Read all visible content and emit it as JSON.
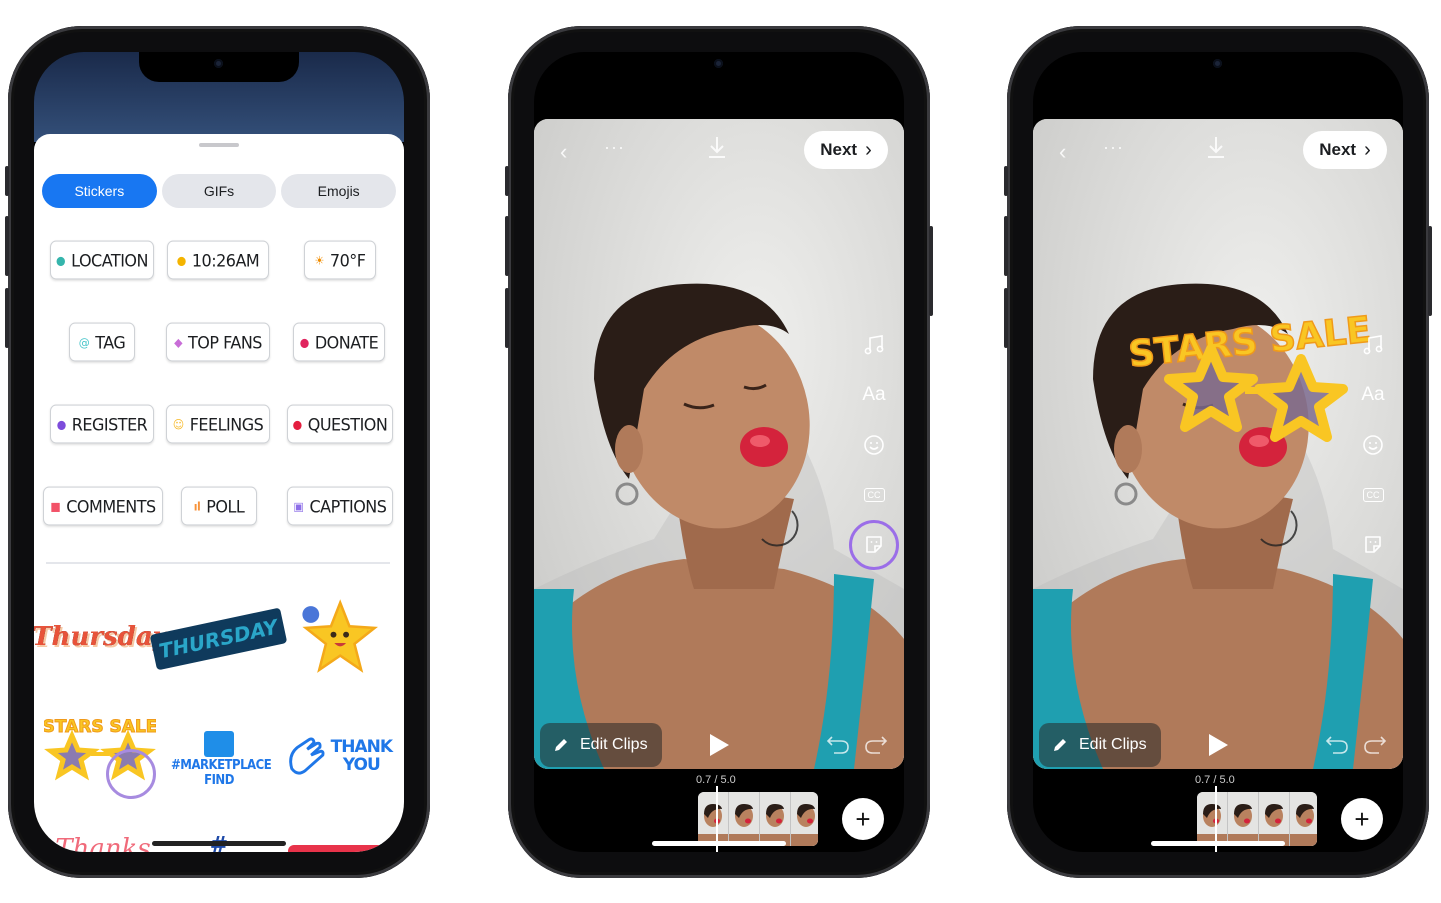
{
  "sticker_panel": {
    "tabs": [
      "Stickers",
      "GIFs",
      "Emojis"
    ],
    "chips": [
      {
        "label": "LOCATION",
        "icon": "location-pin-icon",
        "icon_color": "#35b5ac"
      },
      {
        "label": "10:26AM",
        "icon": "clock-icon",
        "icon_color": "#f4b400"
      },
      {
        "label": "70°F",
        "icon": "sun-icon",
        "icon_color": "#f08c00"
      },
      {
        "label": "TAG",
        "icon": "at-sign-icon",
        "icon_color": "#44c4c9"
      },
      {
        "label": "TOP FANS",
        "icon": "diamond-icon",
        "icon_color": "#c86dd7"
      },
      {
        "label": "DONATE",
        "icon": "heart-hand-icon",
        "icon_color": "#e0245e"
      },
      {
        "label": "REGISTER",
        "icon": "ticket-icon",
        "icon_color": "#7d4cdb"
      },
      {
        "label": "FEELINGS",
        "icon": "smiley-icon",
        "icon_color": "#f7b928"
      },
      {
        "label": "QUESTION",
        "icon": "speech-bubble-icon",
        "icon_color": "#e41e3f"
      },
      {
        "label": "COMMENTS",
        "icon": "comment-icon",
        "icon_color": "#f25268"
      },
      {
        "label": "POLL",
        "icon": "bar-chart-icon",
        "icon_color": "#f7923a"
      },
      {
        "label": "CAPTIONS",
        "icon": "cc-icon",
        "icon_color": "#8c6ee8"
      }
    ],
    "stickers": {
      "thursday_script": "Thursday",
      "thursday_block": "THURSDAY",
      "stars_sale": "STARS SALE",
      "marketplace": "#MARKETPLACE FIND",
      "thank_you_line1": "THANK",
      "thank_you_line2": "YOU",
      "partial_thanks": "Thanks",
      "partial_hash": "#"
    }
  },
  "editor": {
    "next_label": "Next",
    "edit_clips_label": "Edit Clips",
    "timecode": "0.7 / 5.0",
    "add_label": "+",
    "tools": [
      "music-note-icon",
      "text-aa-icon",
      "sticker-smiley-icon",
      "captions-cc-icon",
      "sticker-icon"
    ],
    "text_tool_label": "Aa",
    "cc_label": "CC",
    "overlay_sticker": "STARS SALE",
    "highlight_color": "#9b6ee8"
  }
}
